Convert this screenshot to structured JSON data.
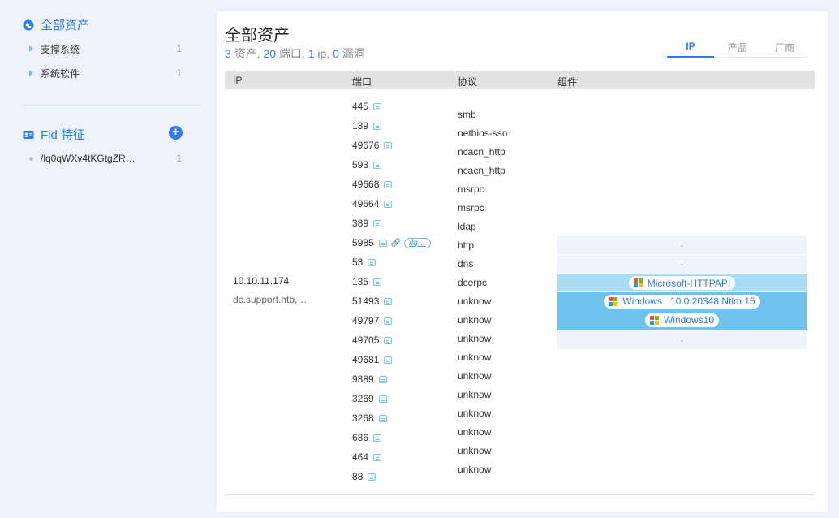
{
  "sidebar": {
    "all_assets": "全部资产",
    "groups": [
      {
        "label": "支撑系统",
        "count": "1"
      },
      {
        "label": "系统软件",
        "count": "1"
      }
    ],
    "fid_title": "Fid 特征",
    "fid_items": [
      {
        "label": "/lq0qWXv4tKGtgZR…",
        "count": "1"
      }
    ]
  },
  "main": {
    "title": "全部资产",
    "summary": {
      "assets_num": "3",
      "assets_label": "资产, ",
      "ports_num": "20",
      "ports_label": "端口, ",
      "ips_num": "1",
      "ips_label": "ip, ",
      "vulns_num": "0",
      "vulns_label": "漏洞"
    },
    "tabs": [
      "IP",
      "产品",
      "厂商"
    ],
    "columns": [
      "IP",
      "端口",
      "协议",
      "组件"
    ],
    "row": {
      "ip": "10.10.11.174",
      "host": "dc.support.htb,…",
      "ports": [
        "445",
        "139",
        "49676",
        "593",
        "49668",
        "49664",
        "389",
        "5985",
        "53",
        "135",
        "51493",
        "49797",
        "49705",
        "49681",
        "9389",
        "3269",
        "3268",
        "636",
        "464",
        "88"
      ],
      "port_link_label": "/lq…",
      "protocols": [
        "smb",
        "netbios-ssn",
        "ncacn_http",
        "ncacn_http",
        "msrpc",
        "msrpc",
        "ldap",
        "http",
        "dns",
        "dcerpc",
        "unknow",
        "unknow",
        "unknow",
        "unknow",
        "unknow",
        "unknow",
        "unknow",
        "unknow",
        "unknow",
        "unknow"
      ],
      "components": {
        "http": "-",
        "dns": "-",
        "dcerpc": "Microsoft-HTTPAPI",
        "os_name": "Windows",
        "os_version": "10.0.20348 Ntlm 15",
        "os_product": "Windows10",
        "unknow": "-"
      }
    }
  },
  "colors": {
    "accent": "#2f7cf6",
    "row_mid": "#a7dbf3",
    "row_strong": "#6fc2ec"
  }
}
